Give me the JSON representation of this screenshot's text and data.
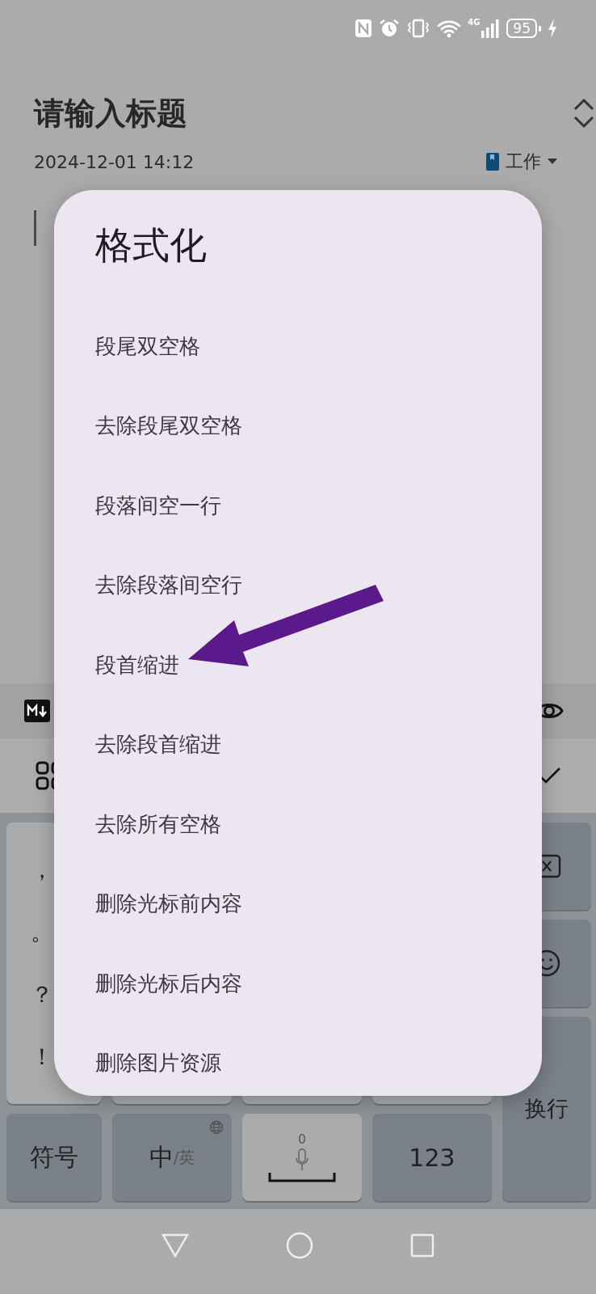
{
  "status_bar": {
    "network": "4G",
    "battery": "95"
  },
  "note": {
    "title": "请输入标题",
    "date": "2024-12-01 14:12",
    "notebook": "工作"
  },
  "dialog": {
    "title": "格式化",
    "items": [
      {
        "label": "段尾双空格",
        "pointed": false
      },
      {
        "label": "去除段尾双空格",
        "pointed": false
      },
      {
        "label": "段落间空一行",
        "pointed": false
      },
      {
        "label": "去除段落间空行",
        "pointed": false
      },
      {
        "label": "段首缩进",
        "pointed": true
      },
      {
        "label": "去除段首缩进",
        "pointed": false
      },
      {
        "label": "去除所有空格",
        "pointed": false
      },
      {
        "label": "删除光标前内容",
        "pointed": false
      },
      {
        "label": "删除光标后内容",
        "pointed": false
      },
      {
        "label": "删除图片资源",
        "pointed": false
      }
    ]
  },
  "keyboard": {
    "punctuation": [
      "，",
      "。",
      "？",
      "！"
    ],
    "symbols_key": "符号",
    "lang_key": {
      "primary": "中",
      "secondary": "/英"
    },
    "space_hint": "0",
    "number_key": "123",
    "enter_key": "换行"
  }
}
